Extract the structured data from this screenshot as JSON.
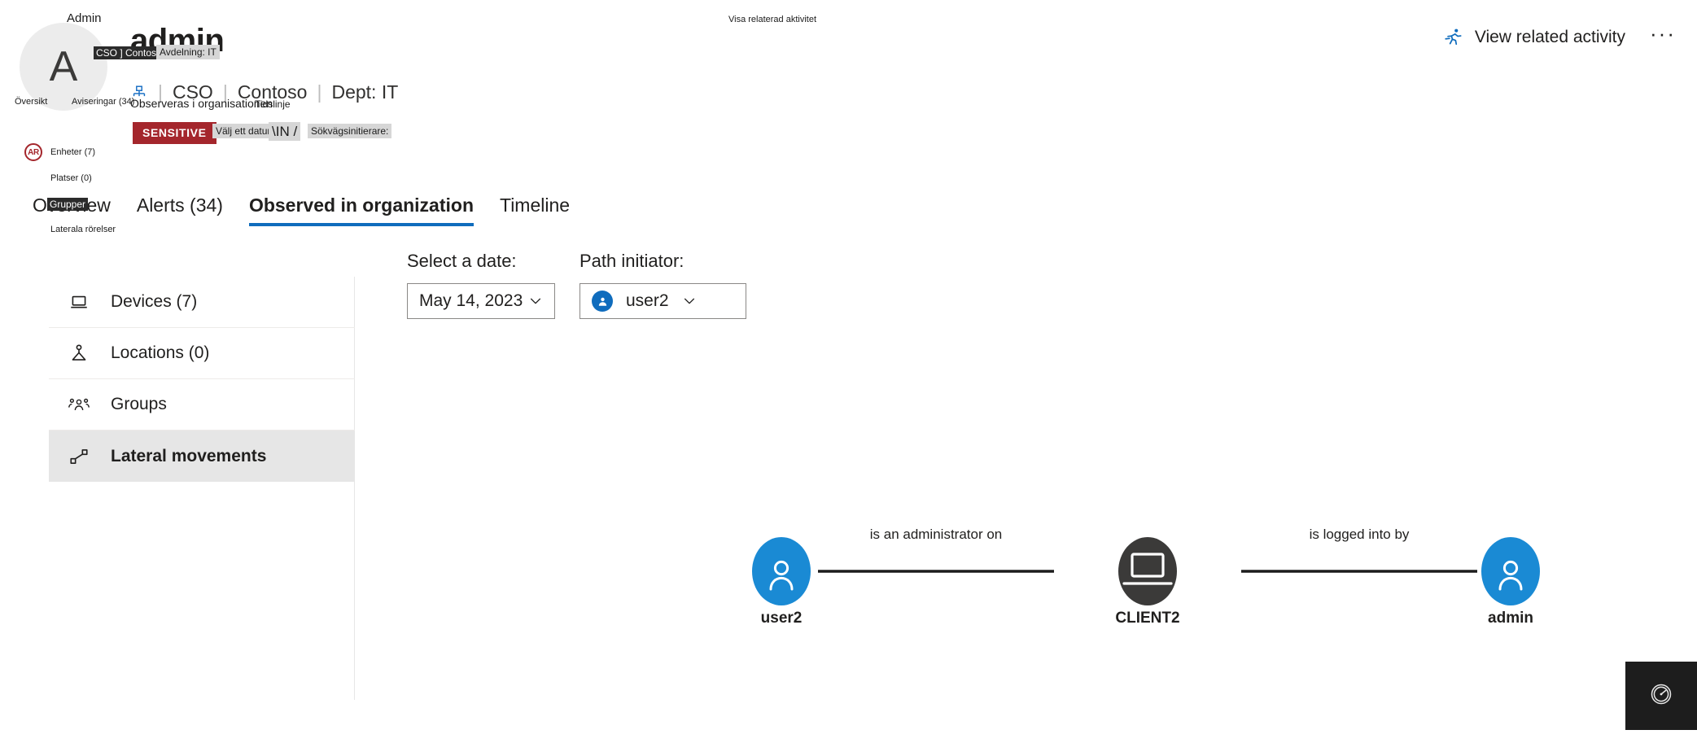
{
  "header": {
    "avatar_initial": "A",
    "entity_name": "admin",
    "breadcrumb": {
      "org_name": "CSO",
      "tenant_name": "Contoso",
      "department": "Dept: IT",
      "separator": "|"
    },
    "sensitive_badge": "SENSITIVE"
  },
  "top_commands": {
    "related_activity_label": "View related activity",
    "related_activity_icon": "running-person-icon",
    "overflow_label": "···",
    "overflow_icon": "more-horizontal-icon"
  },
  "tabs": [
    {
      "label": "Overview",
      "selected": false
    },
    {
      "label": "Alerts (34)",
      "selected": false
    },
    {
      "label": "Observed in organization",
      "selected": true
    },
    {
      "label": "Timeline",
      "selected": false
    }
  ],
  "left_nav": [
    {
      "label": "Devices (7)",
      "icon": "laptop-icon",
      "selected": false
    },
    {
      "label": "Locations (0)",
      "icon": "location-pin-person-icon",
      "selected": false
    },
    {
      "label": "Groups",
      "icon": "people-group-icon",
      "selected": false
    },
    {
      "label": "Lateral movements",
      "icon": "lateral-movement-icon",
      "selected": true
    }
  ],
  "filters": {
    "date": {
      "label": "Select a date:",
      "value": "May 14, 2023",
      "chevron_icon": "chevron-down-icon"
    },
    "path_initiator": {
      "label": "Path initiator:",
      "value": "user2",
      "avatar_icon": "person-icon",
      "chevron_icon": "chevron-down-icon"
    }
  },
  "graph": {
    "nodes": [
      {
        "id": "user2",
        "label": "user2",
        "type": "user",
        "icon": "person-icon",
        "color": "#1a8ad4"
      },
      {
        "id": "client2",
        "label": "CLIENT2",
        "type": "device",
        "icon": "laptop-icon",
        "color": "#3b3a39"
      },
      {
        "id": "admin",
        "label": "admin",
        "type": "user",
        "icon": "person-icon",
        "color": "#1a8ad4"
      }
    ],
    "edges": [
      {
        "from": "user2",
        "to": "client2",
        "label": "is an administrator on"
      },
      {
        "from": "client2",
        "to": "admin",
        "label": "is logged into by"
      }
    ]
  },
  "overlay_labels": {
    "admin_caption": "Admin",
    "org_tooltip": "CSO ] Contoso L",
    "department_tooltip": "Avdelning: IT",
    "tab_overview": "Översikt",
    "tab_alerts": "Aviseringar (34)",
    "tab_observed": "Observeras i organisationen",
    "tab_timeline": "Tidslinje",
    "nav_devices": "Enheter (7)",
    "nav_locations": "Platser (0)",
    "nav_groups": "Grupper",
    "nav_lateral": "Laterala rörelser",
    "filter_date": "Välj ett datum:",
    "filter_domain": "\\IN  /",
    "filter_initiator": "Sökvägsinitierare:",
    "view_related_activity": "Visa relaterad aktivitet",
    "ar_badge": "AR"
  },
  "corner_widget": {
    "icon": "gauge-icon",
    "background": "#1d1d1d"
  },
  "colors": {
    "accent": "#0f6cbd",
    "sensitive": "#a4262c",
    "node_user": "#1a8ad4",
    "node_device": "#3b3a39",
    "selected_nav": "#e6e6e6"
  }
}
